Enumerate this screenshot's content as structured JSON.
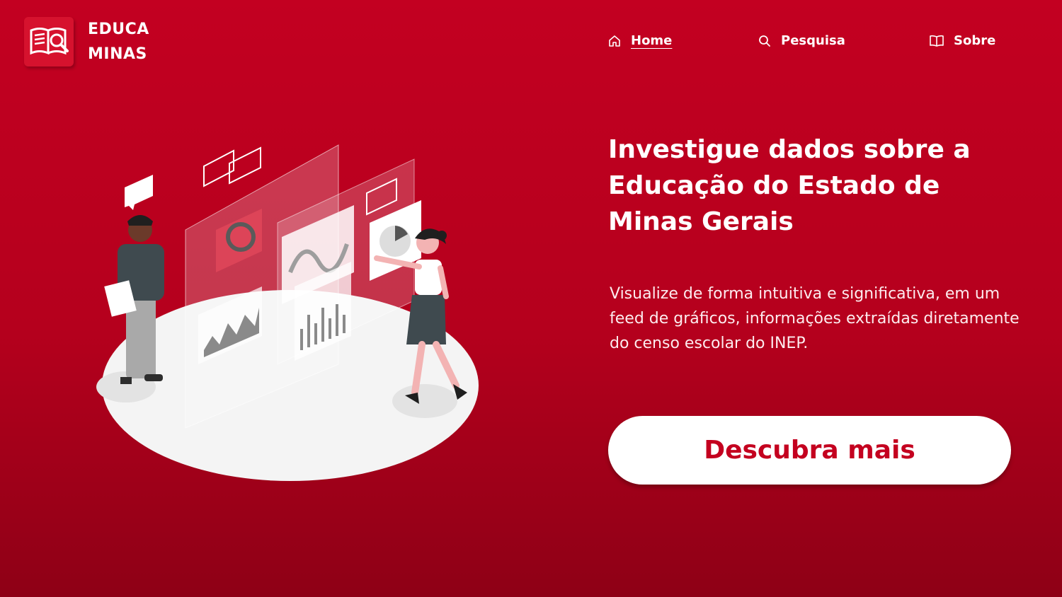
{
  "brand": {
    "line1": "EDUCA",
    "line2": "MINAS",
    "logo_icon": "book-search-icon",
    "badge_color": "#d6122e"
  },
  "nav": {
    "items": [
      {
        "label": "Home",
        "icon": "home-icon",
        "active": true
      },
      {
        "label": "Pesquisa",
        "icon": "search-icon",
        "active": false
      },
      {
        "label": "Sobre",
        "icon": "book-icon",
        "active": false
      }
    ]
  },
  "hero": {
    "title": "Investigue dados sobre a Educação do Estado de Minas Gerais",
    "description": "Visualize de forma intuitiva e significativa, em um feed de gráficos, informações extraídas diretamente do censo escolar do INEP.",
    "cta_label": "Descubra mais"
  },
  "colors": {
    "background_top": "#c30021",
    "background_bottom": "#8e0016",
    "accent": "#c4001f",
    "text": "#ffffff"
  }
}
